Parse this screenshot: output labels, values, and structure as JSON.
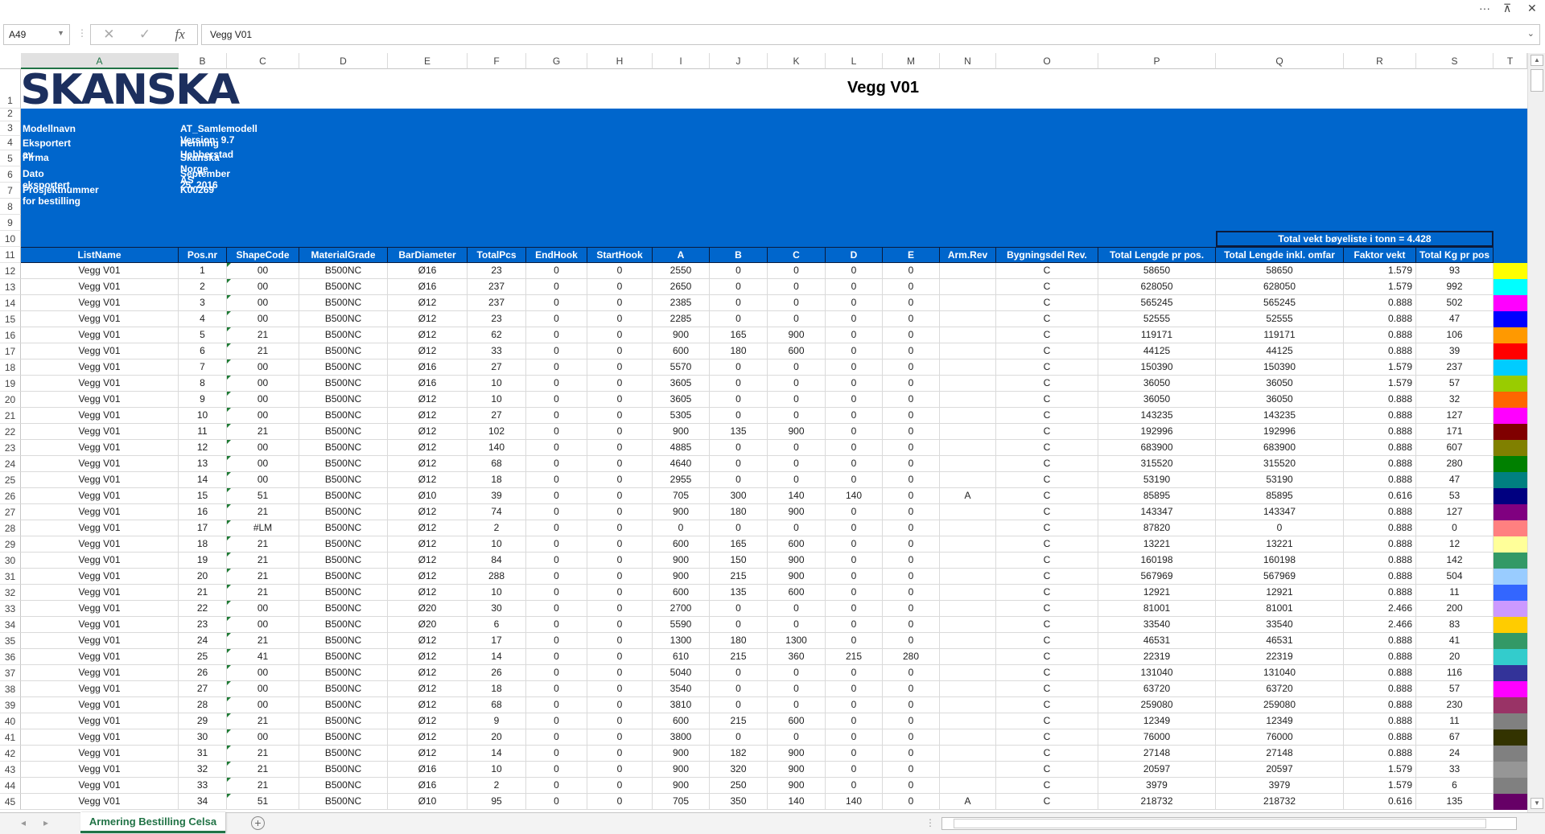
{
  "window": {
    "more_icon": "ellipsis-icon",
    "restore_icon": "restore-icon",
    "close_icon": "close-icon"
  },
  "formula_bar": {
    "name_box": "A49",
    "cancel_icon": "✕",
    "enter_icon": "✓",
    "fx_label": "fx",
    "value": "Vegg V01"
  },
  "columns": [
    "A",
    "B",
    "C",
    "D",
    "E",
    "F",
    "G",
    "H",
    "I",
    "J",
    "K",
    "L",
    "M",
    "N",
    "O",
    "P",
    "Q",
    "R",
    "S",
    "T"
  ],
  "selected_column": "A",
  "row_numbers": [
    "1",
    "2",
    "3",
    "4",
    "5",
    "6",
    "7",
    "8",
    "9",
    "10",
    "11",
    "12",
    "13",
    "14",
    "15",
    "16",
    "17",
    "18",
    "19",
    "20",
    "21",
    "22",
    "23",
    "24",
    "25",
    "26",
    "27",
    "28",
    "29",
    "30",
    "31",
    "32",
    "33",
    "34",
    "35",
    "36",
    "37",
    "38",
    "39",
    "40",
    "41",
    "42",
    "43",
    "44",
    "45"
  ],
  "logo_text": "SKANSKA",
  "title": "Vegg V01",
  "meta": [
    {
      "label": "Modellnavn",
      "value": "AT_Samlemodell Version: 9.7"
    },
    {
      "label": "Eksportert av",
      "value": "Henning Habberstad"
    },
    {
      "label": "Firma",
      "value": "Skanska Norge AS"
    },
    {
      "label": "Dato eksportert",
      "value": "September 25, 2016"
    },
    {
      "label": "Prosjektnummer for bestilling",
      "value": "K00269"
    }
  ],
  "total_weight": "Total vekt bøyeliste i tonn = 4.428",
  "headers": [
    "ListName",
    "Pos.nr",
    "ShapeCode",
    "MaterialGrade",
    "BarDiameter",
    "TotalPcs",
    "EndHook",
    "StartHook",
    "A",
    "B",
    "C",
    "D",
    "E",
    "Arm.Rev",
    "Bygningsdel Rev.",
    "Total Lengde pr pos.",
    "Total Lengde inkl. omfar",
    "Faktor vekt",
    "Total Kg pr pos"
  ],
  "colors": {
    "band": "#0066cc",
    "header_border": "#0b1a3a",
    "logo": "#1c2f5e",
    "tab_accent": "#217346"
  },
  "rows": [
    [
      "Vegg V01",
      "1",
      "00",
      "B500NC",
      "Ø16",
      "23",
      "0",
      "0",
      "2550",
      "0",
      "0",
      "0",
      "0",
      "",
      "C",
      "58650",
      "58650",
      "1.579",
      "93",
      "#FFFF00"
    ],
    [
      "Vegg V01",
      "2",
      "00",
      "B500NC",
      "Ø16",
      "237",
      "0",
      "0",
      "2650",
      "0",
      "0",
      "0",
      "0",
      "",
      "C",
      "628050",
      "628050",
      "1.579",
      "992",
      "#00FFFF"
    ],
    [
      "Vegg V01",
      "3",
      "00",
      "B500NC",
      "Ø12",
      "237",
      "0",
      "0",
      "2385",
      "0",
      "0",
      "0",
      "0",
      "",
      "C",
      "565245",
      "565245",
      "0.888",
      "502",
      "#FF00FF"
    ],
    [
      "Vegg V01",
      "4",
      "00",
      "B500NC",
      "Ø12",
      "23",
      "0",
      "0",
      "2285",
      "0",
      "0",
      "0",
      "0",
      "",
      "C",
      "52555",
      "52555",
      "0.888",
      "47",
      "#0000FF"
    ],
    [
      "Vegg V01",
      "5",
      "21",
      "B500NC",
      "Ø12",
      "62",
      "0",
      "0",
      "900",
      "165",
      "900",
      "0",
      "0",
      "",
      "C",
      "119171",
      "119171",
      "0.888",
      "106",
      "#FF9900"
    ],
    [
      "Vegg V01",
      "6",
      "21",
      "B500NC",
      "Ø12",
      "33",
      "0",
      "0",
      "600",
      "180",
      "600",
      "0",
      "0",
      "",
      "C",
      "44125",
      "44125",
      "0.888",
      "39",
      "#FF0000"
    ],
    [
      "Vegg V01",
      "7",
      "00",
      "B500NC",
      "Ø16",
      "27",
      "0",
      "0",
      "5570",
      "0",
      "0",
      "0",
      "0",
      "",
      "C",
      "150390",
      "150390",
      "1.579",
      "237",
      "#00CCFF"
    ],
    [
      "Vegg V01",
      "8",
      "00",
      "B500NC",
      "Ø16",
      "10",
      "0",
      "0",
      "3605",
      "0",
      "0",
      "0",
      "0",
      "",
      "C",
      "36050",
      "36050",
      "1.579",
      "57",
      "#99CC00"
    ],
    [
      "Vegg V01",
      "9",
      "00",
      "B500NC",
      "Ø12",
      "10",
      "0",
      "0",
      "3605",
      "0",
      "0",
      "0",
      "0",
      "",
      "C",
      "36050",
      "36050",
      "0.888",
      "32",
      "#FF6600"
    ],
    [
      "Vegg V01",
      "10",
      "00",
      "B500NC",
      "Ø12",
      "27",
      "0",
      "0",
      "5305",
      "0",
      "0",
      "0",
      "0",
      "",
      "C",
      "143235",
      "143235",
      "0.888",
      "127",
      "#FF00FF"
    ],
    [
      "Vegg V01",
      "11",
      "21",
      "B500NC",
      "Ø12",
      "102",
      "0",
      "0",
      "900",
      "135",
      "900",
      "0",
      "0",
      "",
      "C",
      "192996",
      "192996",
      "0.888",
      "171",
      "#800000"
    ],
    [
      "Vegg V01",
      "12",
      "00",
      "B500NC",
      "Ø12",
      "140",
      "0",
      "0",
      "4885",
      "0",
      "0",
      "0",
      "0",
      "",
      "C",
      "683900",
      "683900",
      "0.888",
      "607",
      "#808000"
    ],
    [
      "Vegg V01",
      "13",
      "00",
      "B500NC",
      "Ø12",
      "68",
      "0",
      "0",
      "4640",
      "0",
      "0",
      "0",
      "0",
      "",
      "C",
      "315520",
      "315520",
      "0.888",
      "280",
      "#008000"
    ],
    [
      "Vegg V01",
      "14",
      "00",
      "B500NC",
      "Ø12",
      "18",
      "0",
      "0",
      "2955",
      "0",
      "0",
      "0",
      "0",
      "",
      "C",
      "53190",
      "53190",
      "0.888",
      "47",
      "#008080"
    ],
    [
      "Vegg V01",
      "15",
      "51",
      "B500NC",
      "Ø10",
      "39",
      "0",
      "0",
      "705",
      "300",
      "140",
      "140",
      "0",
      "A",
      "C",
      "85895",
      "85895",
      "0.616",
      "53",
      "#000080"
    ],
    [
      "Vegg V01",
      "16",
      "21",
      "B500NC",
      "Ø12",
      "74",
      "0",
      "0",
      "900",
      "180",
      "900",
      "0",
      "0",
      "",
      "C",
      "143347",
      "143347",
      "0.888",
      "127",
      "#800080"
    ],
    [
      "Vegg V01",
      "17",
      "#LM",
      "B500NC",
      "Ø12",
      "2",
      "0",
      "0",
      "0",
      "0",
      "0",
      "0",
      "0",
      "",
      "C",
      "87820",
      "0",
      "0.888",
      "0",
      "#FF8080"
    ],
    [
      "Vegg V01",
      "18",
      "21",
      "B500NC",
      "Ø12",
      "10",
      "0",
      "0",
      "600",
      "165",
      "600",
      "0",
      "0",
      "",
      "C",
      "13221",
      "13221",
      "0.888",
      "12",
      "#FFFF99"
    ],
    [
      "Vegg V01",
      "19",
      "21",
      "B500NC",
      "Ø12",
      "84",
      "0",
      "0",
      "900",
      "150",
      "900",
      "0",
      "0",
      "",
      "C",
      "160198",
      "160198",
      "0.888",
      "142",
      "#339966"
    ],
    [
      "Vegg V01",
      "20",
      "21",
      "B500NC",
      "Ø12",
      "288",
      "0",
      "0",
      "900",
      "215",
      "900",
      "0",
      "0",
      "",
      "C",
      "567969",
      "567969",
      "0.888",
      "504",
      "#99CCFF"
    ],
    [
      "Vegg V01",
      "21",
      "21",
      "B500NC",
      "Ø12",
      "10",
      "0",
      "0",
      "600",
      "135",
      "600",
      "0",
      "0",
      "",
      "C",
      "12921",
      "12921",
      "0.888",
      "11",
      "#3366FF"
    ],
    [
      "Vegg V01",
      "22",
      "00",
      "B500NC",
      "Ø20",
      "30",
      "0",
      "0",
      "2700",
      "0",
      "0",
      "0",
      "0",
      "",
      "C",
      "81001",
      "81001",
      "2.466",
      "200",
      "#CC99FF"
    ],
    [
      "Vegg V01",
      "23",
      "00",
      "B500NC",
      "Ø20",
      "6",
      "0",
      "0",
      "5590",
      "0",
      "0",
      "0",
      "0",
      "",
      "C",
      "33540",
      "33540",
      "2.466",
      "83",
      "#FFCC00"
    ],
    [
      "Vegg V01",
      "24",
      "21",
      "B500NC",
      "Ø12",
      "17",
      "0",
      "0",
      "1300",
      "180",
      "1300",
      "0",
      "0",
      "",
      "C",
      "46531",
      "46531",
      "0.888",
      "41",
      "#339966"
    ],
    [
      "Vegg V01",
      "25",
      "41",
      "B500NC",
      "Ø12",
      "14",
      "0",
      "0",
      "610",
      "215",
      "360",
      "215",
      "280",
      "",
      "C",
      "22319",
      "22319",
      "0.888",
      "20",
      "#33CCCC"
    ],
    [
      "Vegg V01",
      "26",
      "00",
      "B500NC",
      "Ø12",
      "26",
      "0",
      "0",
      "5040",
      "0",
      "0",
      "0",
      "0",
      "",
      "C",
      "131040",
      "131040",
      "0.888",
      "116",
      "#333399"
    ],
    [
      "Vegg V01",
      "27",
      "00",
      "B500NC",
      "Ø12",
      "18",
      "0",
      "0",
      "3540",
      "0",
      "0",
      "0",
      "0",
      "",
      "C",
      "63720",
      "63720",
      "0.888",
      "57",
      "#FF00FF"
    ],
    [
      "Vegg V01",
      "28",
      "00",
      "B500NC",
      "Ø12",
      "68",
      "0",
      "0",
      "3810",
      "0",
      "0",
      "0",
      "0",
      "",
      "C",
      "259080",
      "259080",
      "0.888",
      "230",
      "#993366"
    ],
    [
      "Vegg V01",
      "29",
      "21",
      "B500NC",
      "Ø12",
      "9",
      "0",
      "0",
      "600",
      "215",
      "600",
      "0",
      "0",
      "",
      "C",
      "12349",
      "12349",
      "0.888",
      "11",
      "#808080"
    ],
    [
      "Vegg V01",
      "30",
      "00",
      "B500NC",
      "Ø12",
      "20",
      "0",
      "0",
      "3800",
      "0",
      "0",
      "0",
      "0",
      "",
      "C",
      "76000",
      "76000",
      "0.888",
      "67",
      "#333300"
    ],
    [
      "Vegg V01",
      "31",
      "21",
      "B500NC",
      "Ø12",
      "14",
      "0",
      "0",
      "900",
      "182",
      "900",
      "0",
      "0",
      "",
      "C",
      "27148",
      "27148",
      "0.888",
      "24",
      "#808080"
    ],
    [
      "Vegg V01",
      "32",
      "21",
      "B500NC",
      "Ø16",
      "10",
      "0",
      "0",
      "900",
      "320",
      "900",
      "0",
      "0",
      "",
      "C",
      "20597",
      "20597",
      "1.579",
      "33",
      "#969696"
    ],
    [
      "Vegg V01",
      "33",
      "21",
      "B500NC",
      "Ø16",
      "2",
      "0",
      "0",
      "900",
      "250",
      "900",
      "0",
      "0",
      "",
      "C",
      "3979",
      "3979",
      "1.579",
      "6",
      "#808080"
    ],
    [
      "Vegg V01",
      "34",
      "51",
      "B500NC",
      "Ø10",
      "95",
      "0",
      "0",
      "705",
      "350",
      "140",
      "140",
      "0",
      "A",
      "C",
      "218732",
      "218732",
      "0.616",
      "135",
      "#660066"
    ]
  ],
  "sheet_tabs": [
    {
      "label": "Armering Bestilling Celsa",
      "active": true
    }
  ],
  "add_sheet_icon": "+"
}
